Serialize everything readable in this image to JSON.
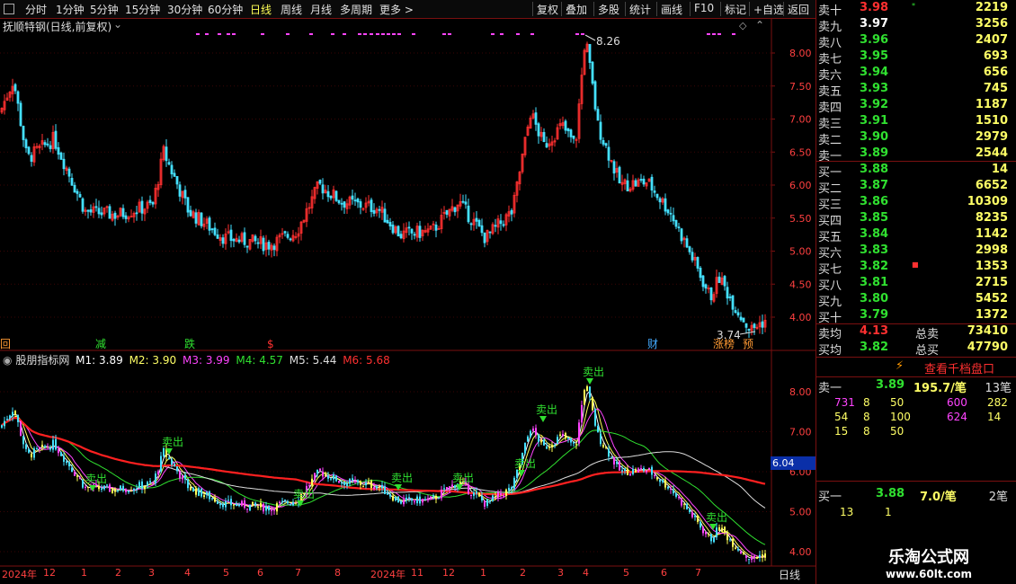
{
  "toolbar": {
    "left_items": [
      {
        "label": "分时",
        "active": false
      },
      {
        "label": "1分钟",
        "active": false
      },
      {
        "label": "5分钟",
        "active": false
      },
      {
        "label": "15分钟",
        "active": false
      },
      {
        "label": "30分钟",
        "active": false
      },
      {
        "label": "60分钟",
        "active": false
      },
      {
        "label": "日线",
        "active": true
      },
      {
        "label": "周线",
        "active": false
      },
      {
        "label": "月线",
        "active": false
      },
      {
        "label": "多周期",
        "active": false
      },
      {
        "label": "更多 >",
        "active": false
      }
    ],
    "right_items": [
      "复权",
      "叠加",
      "多股",
      "统计",
      "画线",
      "F10",
      "标记",
      "+自选",
      "返回"
    ]
  },
  "price_panel": {
    "title": "抚顺特钢(日线,前复权)",
    "high_label": "8.26",
    "low_label": "3.74",
    "y_ticks": [
      "8.00",
      "7.50",
      "7.00",
      "6.50",
      "6.00",
      "5.50",
      "5.00",
      "4.50",
      "4.00"
    ],
    "events": [
      {
        "text": "回",
        "color": "#ff9933"
      },
      {
        "text": "减",
        "color": "#30e030"
      },
      {
        "text": "跌",
        "color": "#30e030"
      },
      {
        "text": "$",
        "color": "#ff3030"
      },
      {
        "text": "财",
        "color": "#44aaff"
      },
      {
        "text": "涨榜",
        "color": "#ff9933"
      },
      {
        "text": "预",
        "color": "#ff9933"
      }
    ]
  },
  "indicator_panel": {
    "name": "股朋指标网",
    "m1": "M1: 3.89",
    "m2": "M2: 3.90",
    "m3": "M3: 3.99",
    "m4": "M4: 4.57",
    "m5": "M5: 5.44",
    "m6": "M6: 5.68",
    "marker_value": "6.04",
    "y_ticks": [
      "8.00",
      "7.00",
      "6.00",
      "5.00",
      "4.00"
    ],
    "sell_label": "卖出"
  },
  "x_axis": {
    "labels": [
      "2024年",
      "12",
      "1",
      "2",
      "3",
      "4",
      "5",
      "6",
      "7",
      "8",
      "2024年",
      "11",
      "12",
      "1",
      "2",
      "3",
      "4",
      "5",
      "6",
      "7"
    ],
    "period": "日线"
  },
  "order_book": {
    "asks": [
      {
        "label": "卖十",
        "price": "3.98",
        "vol": "2219",
        "color": "#ff3030",
        "mark": "*"
      },
      {
        "label": "卖九",
        "price": "3.97",
        "vol": "3256",
        "color": "#ffffff"
      },
      {
        "label": "卖八",
        "price": "3.96",
        "vol": "2407",
        "color": "#30e030"
      },
      {
        "label": "卖七",
        "price": "3.95",
        "vol": "693",
        "color": "#30e030"
      },
      {
        "label": "卖六",
        "price": "3.94",
        "vol": "656",
        "color": "#30e030"
      },
      {
        "label": "卖五",
        "price": "3.93",
        "vol": "745",
        "color": "#30e030"
      },
      {
        "label": "卖四",
        "price": "3.92",
        "vol": "1187",
        "color": "#30e030"
      },
      {
        "label": "卖三",
        "price": "3.91",
        "vol": "1510",
        "color": "#30e030"
      },
      {
        "label": "卖二",
        "price": "3.90",
        "vol": "2979",
        "color": "#30e030"
      },
      {
        "label": "卖一",
        "price": "3.89",
        "vol": "2544",
        "color": "#30e030"
      }
    ],
    "bids": [
      {
        "label": "买一",
        "price": "3.88",
        "vol": "14",
        "color": "#30e030"
      },
      {
        "label": "买二",
        "price": "3.87",
        "vol": "6652",
        "color": "#30e030"
      },
      {
        "label": "买三",
        "price": "3.86",
        "vol": "10309",
        "color": "#30e030"
      },
      {
        "label": "买四",
        "price": "3.85",
        "vol": "8235",
        "color": "#30e030"
      },
      {
        "label": "买五",
        "price": "3.84",
        "vol": "1142",
        "color": "#30e030"
      },
      {
        "label": "买六",
        "price": "3.83",
        "vol": "2998",
        "color": "#30e030"
      },
      {
        "label": "买七",
        "price": "3.82",
        "vol": "1353",
        "color": "#30e030",
        "mark": "■"
      },
      {
        "label": "买八",
        "price": "3.81",
        "vol": "2715",
        "color": "#30e030"
      },
      {
        "label": "买九",
        "price": "3.80",
        "vol": "5452",
        "color": "#30e030"
      },
      {
        "label": "买十",
        "price": "3.79",
        "vol": "1372",
        "color": "#30e030"
      }
    ],
    "avg_sell_label": "卖均",
    "avg_sell": "4.13",
    "total_sell_label": "总卖",
    "total_sell": "73410",
    "avg_buy_label": "买均",
    "avg_buy": "3.82",
    "total_buy_label": "总买",
    "total_buy": "47790",
    "thousand_button": "查看千档盘口",
    "lightning_icon": "lightning-icon",
    "ask1": {
      "label": "卖一",
      "price": "3.89",
      "per": "195.7/笔",
      "count": "13笔"
    },
    "ask1_queue": [
      [
        "731",
        "8",
        "50",
        "600",
        "282"
      ],
      [
        "54",
        "8",
        "100",
        "624",
        "14"
      ],
      [
        "15",
        "8",
        "50",
        "",
        ""
      ]
    ],
    "bid1": {
      "label": "买一",
      "price": "3.88",
      "per": "7.0/笔",
      "count": "2笔"
    },
    "bid1_queue": [
      [
        "13",
        "1"
      ]
    ]
  },
  "watermark": {
    "title": "乐淘公式网",
    "url": "www.60lt.com"
  },
  "colors": {
    "up": "#ff3030",
    "down": "#44e0ff",
    "grid": "#7a1010",
    "axis_text": "#ff4040"
  }
}
